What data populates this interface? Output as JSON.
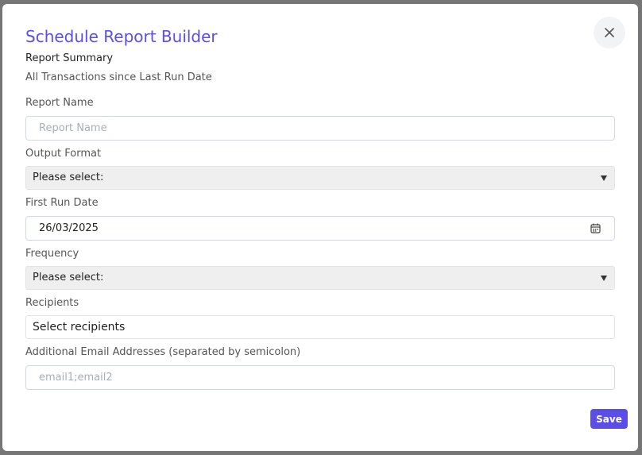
{
  "modal": {
    "title": "Schedule Report Builder",
    "summary_heading": "Report Summary",
    "summary_text": "All Transactions since Last Run Date",
    "close_icon": "close-icon"
  },
  "form": {
    "report_name": {
      "label": "Report Name",
      "value": "",
      "placeholder": "Report Name"
    },
    "output_format": {
      "label": "Output Format",
      "selected": "Please select:"
    },
    "first_run_date": {
      "label": "First Run Date",
      "value": "26/03/2025",
      "icon": "calendar-icon"
    },
    "frequency": {
      "label": "Frequency",
      "selected": "Please select:"
    },
    "recipients": {
      "label": "Recipients",
      "value": "Select recipients"
    },
    "additional_emails": {
      "label": "Additional Email Addresses (separated by semicolon)",
      "value": "",
      "placeholder": "email1;email2"
    }
  },
  "actions": {
    "save_label": "Save"
  },
  "colors": {
    "accent": "#5b4ee8",
    "backdrop": "#767676",
    "select_bg": "#efefef"
  }
}
